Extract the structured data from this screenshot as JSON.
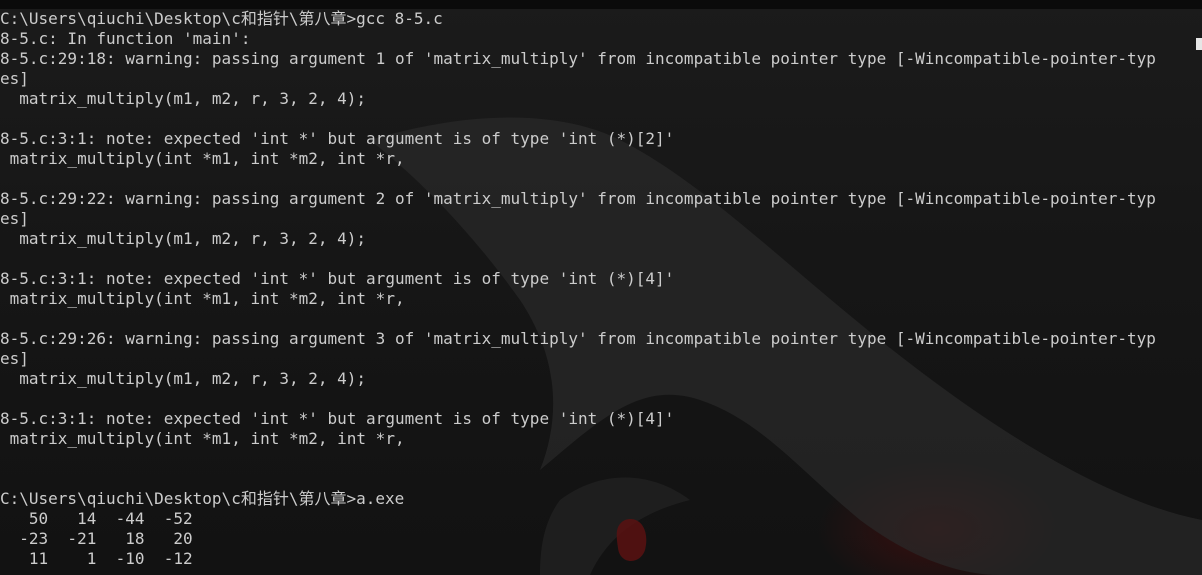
{
  "console": {
    "lines": [
      "C:\\Users\\qiuchi\\Desktop\\c和指针\\第八章>gcc 8-5.c",
      "8-5.c: In function 'main':",
      "8-5.c:29:18: warning: passing argument 1 of 'matrix_multiply' from incompatible pointer type [-Wincompatible-pointer-typ",
      "es]",
      "  matrix_multiply(m1, m2, r, 3, 2, 4);",
      "",
      "8-5.c:3:1: note: expected 'int *' but argument is of type 'int (*)[2]'",
      " matrix_multiply(int *m1, int *m2, int *r,",
      "",
      "8-5.c:29:22: warning: passing argument 2 of 'matrix_multiply' from incompatible pointer type [-Wincompatible-pointer-typ",
      "es]",
      "  matrix_multiply(m1, m2, r, 3, 2, 4);",
      "",
      "8-5.c:3:1: note: expected 'int *' but argument is of type 'int (*)[4]'",
      " matrix_multiply(int *m1, int *m2, int *r,",
      "",
      "8-5.c:29:26: warning: passing argument 3 of 'matrix_multiply' from incompatible pointer type [-Wincompatible-pointer-typ",
      "es]",
      "  matrix_multiply(m1, m2, r, 3, 2, 4);",
      "",
      "8-5.c:3:1: note: expected 'int *' but argument is of type 'int (*)[4]'",
      " matrix_multiply(int *m1, int *m2, int *r,",
      "",
      "",
      "C:\\Users\\qiuchi\\Desktop\\c和指针\\第八章>a.exe",
      "   50   14  -44  -52",
      "  -23  -21   18   20",
      "   11    1  -10  -12"
    ]
  },
  "colors": {
    "text": "#cccccc",
    "background": "#141414"
  }
}
